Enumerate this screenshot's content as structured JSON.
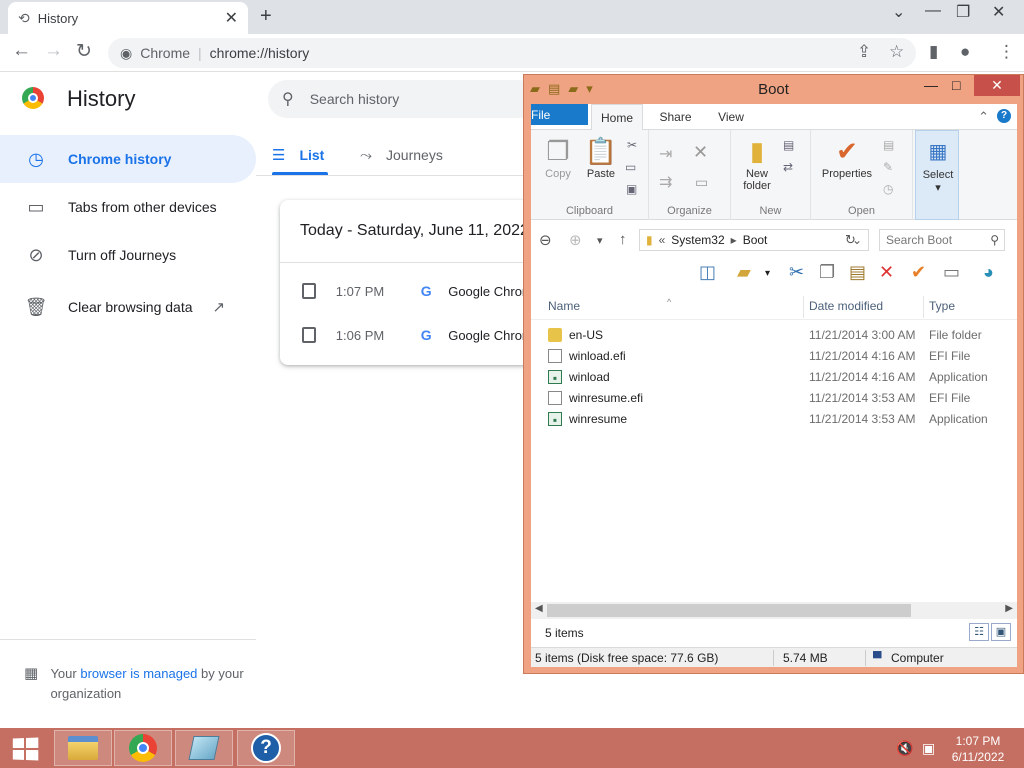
{
  "browser": {
    "tab_title": "History",
    "tab_icon": "history-icon",
    "omnibox": {
      "site_label": "Chrome",
      "url": "chrome://history"
    }
  },
  "history": {
    "title": "History",
    "search_placeholder": "Search history",
    "nav": [
      {
        "label": "Chrome history",
        "icon": "clock-icon"
      },
      {
        "label": "Tabs from other devices",
        "icon": "devices-icon"
      },
      {
        "label": "Turn off Journeys",
        "icon": "journeys-off-icon"
      },
      {
        "label": "Clear browsing data",
        "icon": "trash-icon"
      }
    ],
    "managed": {
      "prefix": "Your",
      "link": "browser is managed",
      "suffix": "by your organization"
    },
    "tabs": [
      {
        "label": "List"
      },
      {
        "label": "Journeys"
      }
    ],
    "date_header": "Today - Saturday, June 11, 2022",
    "entries": [
      {
        "time": "1:07 PM",
        "site": "Google Chrome"
      },
      {
        "time": "1:06 PM",
        "site": "Google Chrome"
      }
    ]
  },
  "explorer": {
    "title": "Boot",
    "ribbon_tabs": [
      "File",
      "Home",
      "Share",
      "View"
    ],
    "groups": {
      "clipboard": {
        "label": "Clipboard",
        "copy": "Copy",
        "paste": "Paste"
      },
      "organize": {
        "label": "Organize"
      },
      "new": {
        "label": "New",
        "new_folder_line1": "New",
        "new_folder_line2": "folder"
      },
      "open": {
        "label": "Open",
        "properties": "Properties"
      },
      "select": {
        "label": "Select"
      }
    },
    "address": {
      "overflow": "«",
      "crumbs": [
        "System32",
        "Boot"
      ]
    },
    "search_placeholder": "Search Boot",
    "columns": {
      "name": "Name",
      "date": "Date modified",
      "type": "Type"
    },
    "files": [
      {
        "name": "en-US",
        "date": "11/21/2014 3:00 AM",
        "type": "File folder",
        "icon": "folder-icon"
      },
      {
        "name": "winload.efi",
        "date": "11/21/2014 4:16 AM",
        "type": "EFI File",
        "icon": "file-icon"
      },
      {
        "name": "winload",
        "date": "11/21/2014 4:16 AM",
        "type": "Application",
        "icon": "application-icon"
      },
      {
        "name": "winresume.efi",
        "date": "11/21/2014 3:53 AM",
        "type": "EFI File",
        "icon": "file-icon"
      },
      {
        "name": "winresume",
        "date": "11/21/2014 3:53 AM",
        "type": "Application",
        "icon": "application-icon"
      }
    ],
    "item_count": "5 items",
    "status": {
      "items_free": "5 items (Disk free space: 77.6 GB)",
      "size": "5.74 MB",
      "location": "Computer"
    }
  },
  "taskbar": {
    "time": "1:07 PM",
    "date": "6/11/2022"
  },
  "colors": {
    "chrome_accent": "#1a73e8",
    "explorer_frame": "#f0a382",
    "taskbar": "#c46f62",
    "ribbon_file_tab": "#1979ca"
  }
}
